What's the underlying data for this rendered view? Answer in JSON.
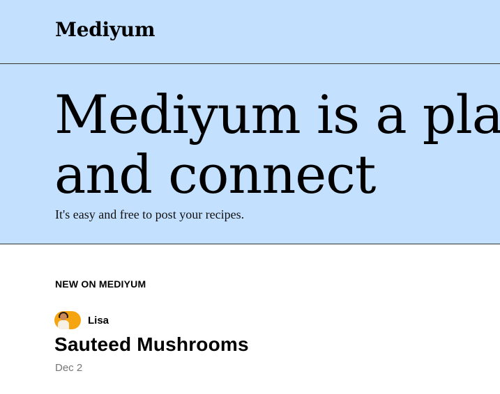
{
  "header": {
    "logo": "Mediyum"
  },
  "hero": {
    "title_line1": "Mediyum is a pla",
    "title_line2": "and connect",
    "subtitle": "It's easy and free to post your recipes."
  },
  "feed": {
    "section_label": "NEW ON MEDIYUM",
    "posts": [
      {
        "author": "Lisa",
        "title": "Sauteed Mushrooms",
        "date": "Dec 2"
      }
    ]
  },
  "colors": {
    "header_bg": "#c3e0ff",
    "avatar_bg": "#f5a512",
    "date_text": "#757575"
  }
}
